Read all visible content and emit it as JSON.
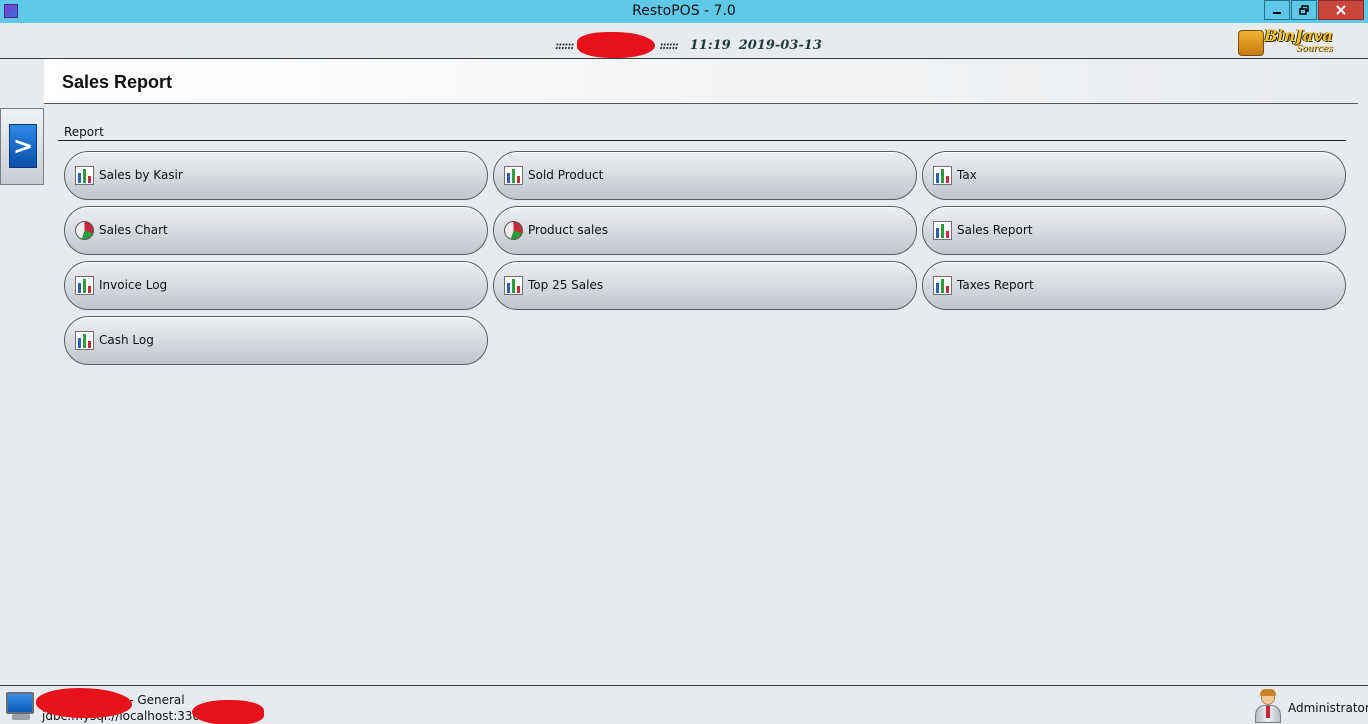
{
  "window": {
    "title": "RestoPOS - 7.0",
    "minimize_icon": "minimize-icon",
    "maximize_icon": "restore-icon",
    "close_icon": "close-icon",
    "close_color": "#c9463d",
    "titlebar_color": "#5fc8e8"
  },
  "header": {
    "dots_left": "::::::",
    "dots_right": "::::::",
    "time": "11:19",
    "date": "2019-03-13",
    "brand": "BinJava",
    "brand_sub": "Sources"
  },
  "sidebar": {
    "toggle_icon": "chevron-right-icon",
    "toggle_glyph": ">"
  },
  "page": {
    "title": "Sales Report",
    "group_label": "Report"
  },
  "reports": [
    {
      "label": "Sales by Kasir",
      "icon": "bar-chart-icon"
    },
    {
      "label": "Sold Product",
      "icon": "bar-chart-icon"
    },
    {
      "label": "Tax",
      "icon": "bar-chart-icon"
    },
    {
      "label": "Sales Chart",
      "icon": "pie-chart-icon"
    },
    {
      "label": "Product sales",
      "icon": "pie-chart-icon"
    },
    {
      "label": "Sales Report",
      "icon": "bar-chart-icon"
    },
    {
      "label": "Invoice Log",
      "icon": "bar-chart-icon"
    },
    {
      "label": "Top 25 Sales",
      "icon": "bar-chart-icon"
    },
    {
      "label": "Taxes Report",
      "icon": "bar-chart-icon"
    },
    {
      "label": "Cash Log",
      "icon": "bar-chart-icon"
    }
  ],
  "status": {
    "db_line1": "a - General",
    "db_line2": "jdbc:mysql://localhost:3306/",
    "user": "Administrator",
    "monitor_icon": "monitor-icon",
    "user_icon": "user-icon"
  }
}
